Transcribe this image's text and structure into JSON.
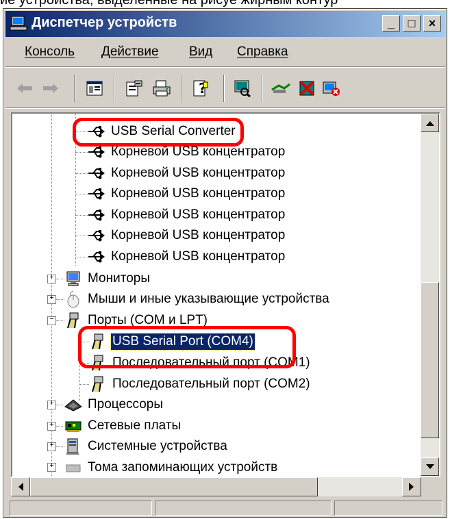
{
  "caption": "ие устройства, выделенные на рисуе жирным контур",
  "window": {
    "title": "Диспетчер устройств",
    "controls": {
      "minimize": "_",
      "maximize": "□",
      "close": "×"
    }
  },
  "menu": {
    "items": [
      "Консоль",
      "Действие",
      "Вид",
      "Справка"
    ]
  },
  "toolbar": {
    "buttons": [
      "back-arrow-icon",
      "forward-arrow-icon",
      "console-tree-icon",
      "properties-icon",
      "print-icon",
      "help-icon",
      "scan-hardware-icon",
      "update-driver-icon",
      "disable-device-icon",
      "uninstall-device-icon"
    ]
  },
  "tree": {
    "usb_items": [
      "USB Serial Converter",
      "Корневой USB концентратор",
      "Корневой USB концентратор",
      "Корневой USB концентратор",
      "Корневой USB концентратор",
      "Корневой USB концентратор",
      "Корневой USB концентратор"
    ],
    "monitors": "Мониторы",
    "mice": "Мыши и иные указывающие устройства",
    "ports": "Порты (COM и LPT)",
    "port_items": [
      "USB Serial Port (COM4)",
      "Последовательный порт (COM1)",
      "Последовательный порт (COM2)"
    ],
    "processors": "Процессоры",
    "network": "Сетевые платы",
    "system": "Системные устройства",
    "other": "Тома запоминающих устройств",
    "expand_plus": "+",
    "expand_minus": "−"
  },
  "colors": {
    "selection": "#0a246a",
    "highlight": "#ff0000",
    "face": "#d4d0c8"
  }
}
